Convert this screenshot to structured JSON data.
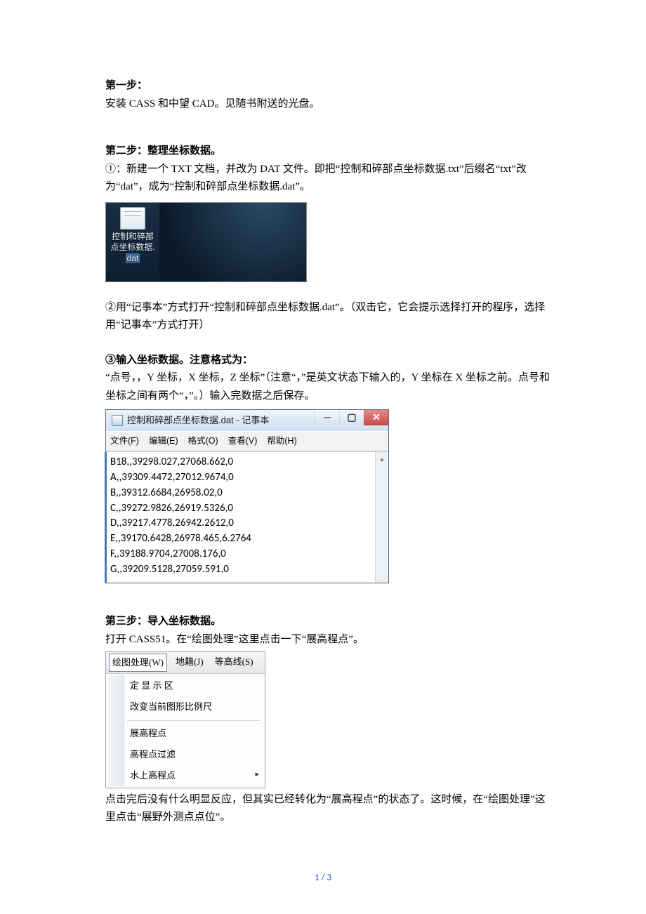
{
  "step1": {
    "title": "第一步：",
    "body": "安装 CASS 和中望 CAD。见随书附送的光盘。"
  },
  "step2": {
    "title": "第二步：整理坐标数据。",
    "p1": "①：新建一个 TXT 文档，并改为 DAT 文件。即把“控制和碎部点坐标数据.txt”后缀名“txt”改为“dat”，成为“控制和碎部点坐标数据.dat”。",
    "desktop_icon_label_line1": "控制和碎部",
    "desktop_icon_label_line2": "点坐标数据.",
    "desktop_icon_label_line3": "dat",
    "p2": "②用“记事本”方式打开“控制和碎部点坐标数据.dat”。（双击它，它会提示选择打开的程序，选择用“记事本”方式打开）",
    "p3_title": "③输入坐标数据。注意格式为：",
    "p3_body": "“点号，，Y 坐标，X 坐标，Z 坐标”（注意“，”是英文状态下输入的，Y 坐标在 X 坐标之前。点号和坐标之间有两个“，”。）输入完数据之后保存。"
  },
  "notepad": {
    "title": "控制和碎部点坐标数据.dat - 记事本",
    "menus": [
      "文件(F)",
      "编辑(E)",
      "格式(O)",
      "查看(V)",
      "帮助(H)"
    ],
    "lines": [
      "B18,,39298.027,27068.662,0",
      "A,,39309.4472,27012.9674,0",
      "B,,39312.6684,26958.02,0",
      "C,,39272.9826,26919.5326,0",
      "D,,39217.4778,26942.2612,0",
      "E,,39170.6428,26978.465,6.2764",
      "F,,39188.9704,27008.176,0",
      "G,,39209.5128,27059.591,0"
    ]
  },
  "step3": {
    "title": "第三步：导入坐标数据。",
    "p1": "打开 CASS51。在“绘图处理”这里点击一下“展高程点”。",
    "menu_bar": [
      "绘图处理(W)",
      "地籍(J)",
      "等高线(S)"
    ],
    "menu_items": [
      "定 显 示 区",
      "改变当前图形比例尺",
      "|",
      "展高程点",
      "高程点过滤",
      "水上高程点"
    ],
    "p2": "点击完后没有什么明显反应，但其实已经转化为“展高程点”的状态了。这时候，在“绘图处理”这里点击“展野外测点点位”。"
  },
  "footer": "1 / 3"
}
